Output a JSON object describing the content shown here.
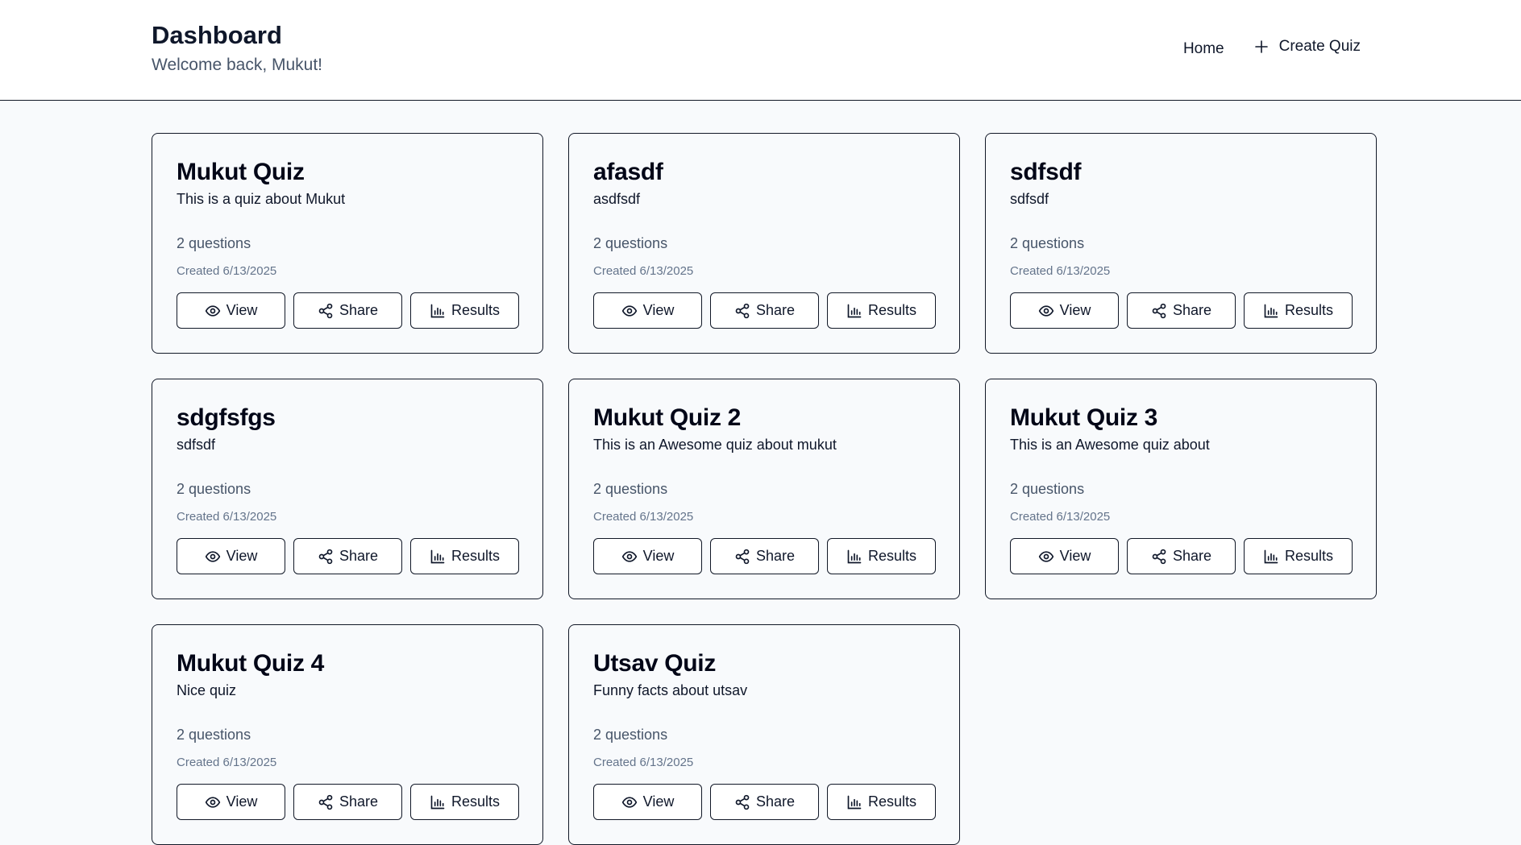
{
  "header": {
    "title": "Dashboard",
    "welcome": "Welcome back, Mukut!",
    "nav": {
      "home": "Home",
      "create_quiz": "Create Quiz"
    }
  },
  "actions": {
    "view": "View",
    "share": "Share",
    "results": "Results"
  },
  "quizzes": [
    {
      "title": "Mukut Quiz",
      "description": "This is a quiz about Mukut",
      "questions": "2 questions",
      "created": "Created 6/13/2025"
    },
    {
      "title": "afasdf",
      "description": "asdfsdf",
      "questions": "2 questions",
      "created": "Created 6/13/2025"
    },
    {
      "title": "sdfsdf",
      "description": "sdfsdf",
      "questions": "2 questions",
      "created": "Created 6/13/2025"
    },
    {
      "title": "sdgfsfgs",
      "description": "sdfsdf",
      "questions": "2 questions",
      "created": "Created 6/13/2025"
    },
    {
      "title": "Mukut Quiz 2",
      "description": "This is an Awesome quiz about mukut",
      "questions": "2 questions",
      "created": "Created 6/13/2025"
    },
    {
      "title": "Mukut Quiz 3",
      "description": "This is an Awesome quiz about",
      "questions": "2 questions",
      "created": "Created 6/13/2025"
    },
    {
      "title": "Mukut Quiz 4",
      "description": "Nice quiz",
      "questions": "2 questions",
      "created": "Created 6/13/2025"
    },
    {
      "title": "Utsav Quiz",
      "description": "Funny facts about utsav",
      "questions": "2 questions",
      "created": "Created 6/13/2025"
    }
  ]
}
